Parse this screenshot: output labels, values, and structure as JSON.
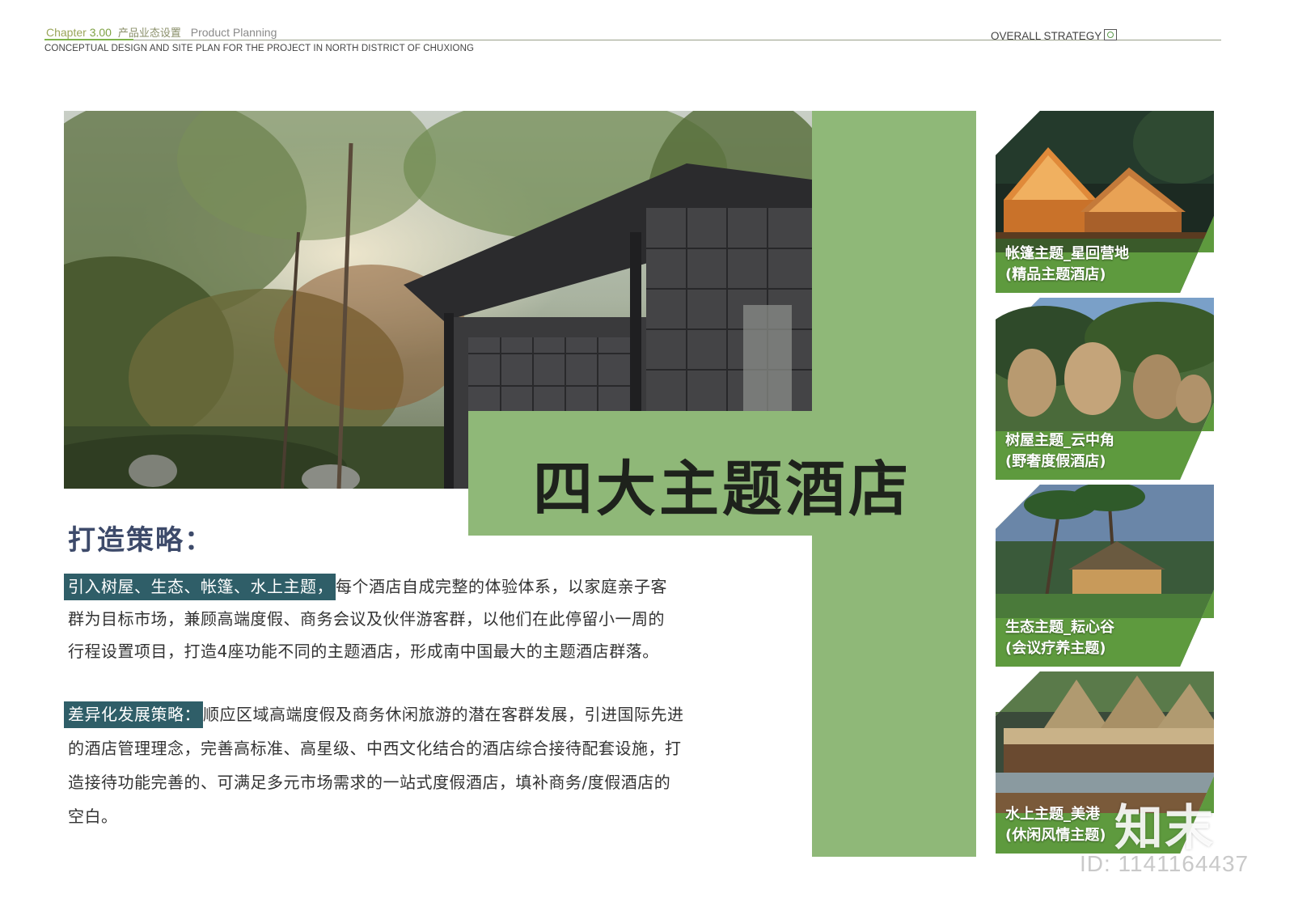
{
  "header": {
    "chapter_label": "Chapter",
    "chapter_number": "3.00",
    "section_cn": "产品业态设置",
    "section_en": "Product Planning",
    "subtitle": "CONCEPTUAL DESIGN AND  SITE PLAN  FOR THE  PROJECT IN NORTH DISTRICT OF CHUXIONG",
    "right_label": "OVERALL STRATEGY"
  },
  "hero": {
    "title": "四大主题酒店"
  },
  "strategy": {
    "heading": "打造策略：",
    "paragraph1": {
      "highlight": "引入树屋、生态、帐篷、水上主题，",
      "line1_rest": "每个酒店自成完整的体验体系，以家庭亲子客",
      "line2": "群为目标市场，兼顾高端度假、商务会议及伙伴游客群，以他们在此停留小一周的",
      "line3": "行程设置项目，打造4座功能不同的主题酒店，形成南中国最大的主题酒店群落。"
    },
    "paragraph2": {
      "highlight": "差异化发展策略：",
      "line1_rest": "顺应区域高端度假及商务休闲旅游的潜在客群发展，引进国际先进",
      "line2": "的酒店管理理念，完善高标准、高星级、中西文化结合的酒店综合接待配套设施，打",
      "line3": "造接待功能完善的、可满足多元市场需求的一站式度假酒店，填补商务/度假酒店的",
      "line4": "空白。"
    }
  },
  "themes": [
    {
      "line1": "帐篷主题_星回营地",
      "line2": "(精品主题酒店)"
    },
    {
      "line1": "树屋主题_云中角",
      "line2": "(野奢度假酒店)"
    },
    {
      "line1": "生态主题_耘心谷",
      "line2": "(会议疗养主题)"
    },
    {
      "line1": "水上主题_美港",
      "line2": "(休闲风情主题)"
    }
  ],
  "watermark": {
    "brand": "知末",
    "id": "ID: 1141164437"
  },
  "colors": {
    "accent_green": "#8fb878",
    "highlight_teal": "#2f5e68",
    "heading_navy": "#3d4a6a"
  }
}
